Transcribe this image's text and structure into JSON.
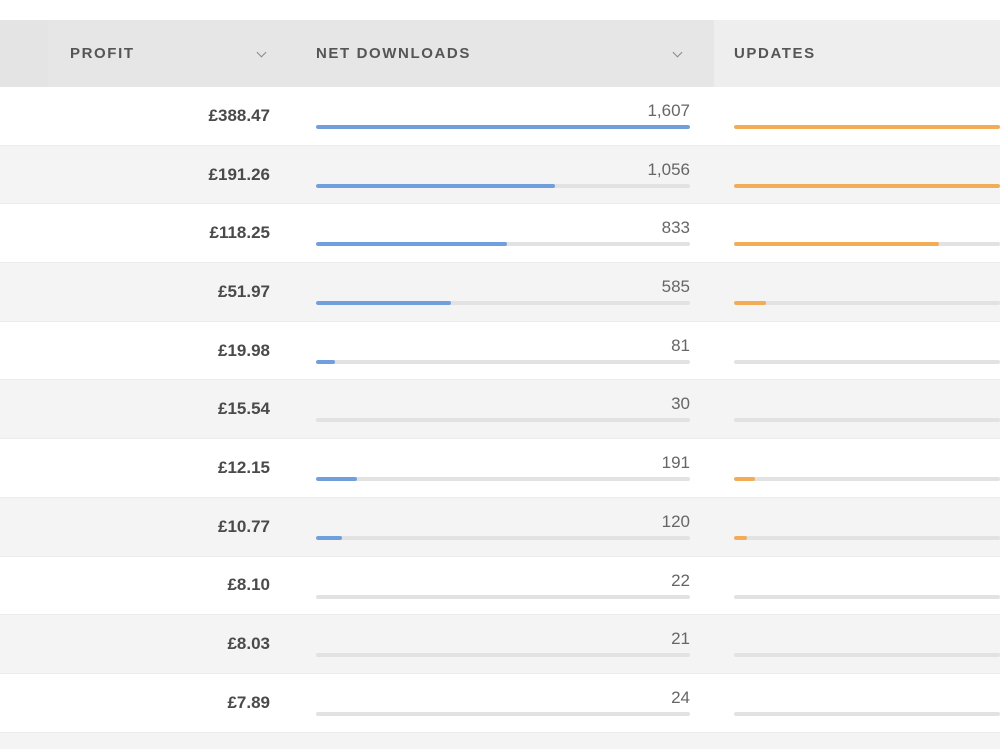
{
  "header": {
    "profit_label": "PROFIT",
    "net_downloads_label": "NET DOWNLOADS",
    "updates_label": "UPDATES"
  },
  "colors": {
    "net_downloads_bar": "#6f9fdc",
    "updates_bar": "#f2ac58",
    "track": "#e2e2e2"
  },
  "rows": [
    {
      "profit": "£388.47",
      "net_downloads": "1,607",
      "net_fraction": 1.0,
      "updates_fraction": 1.0
    },
    {
      "profit": "£191.26",
      "net_downloads": "1,056",
      "net_fraction": 0.64,
      "updates_fraction": 1.0
    },
    {
      "profit": "£118.25",
      "net_downloads": "833",
      "net_fraction": 0.51,
      "updates_fraction": 0.77
    },
    {
      "profit": "£51.97",
      "net_downloads": "585",
      "net_fraction": 0.36,
      "updates_fraction": 0.12
    },
    {
      "profit": "£19.98",
      "net_downloads": "81",
      "net_fraction": 0.05,
      "updates_fraction": 0.0
    },
    {
      "profit": "£15.54",
      "net_downloads": "30",
      "net_fraction": 0.0,
      "updates_fraction": 0.0
    },
    {
      "profit": "£12.15",
      "net_downloads": "191",
      "net_fraction": 0.11,
      "updates_fraction": 0.08
    },
    {
      "profit": "£10.77",
      "net_downloads": "120",
      "net_fraction": 0.07,
      "updates_fraction": 0.05
    },
    {
      "profit": "£8.10",
      "net_downloads": "22",
      "net_fraction": 0.0,
      "updates_fraction": 0.0
    },
    {
      "profit": "£8.03",
      "net_downloads": "21",
      "net_fraction": 0.0,
      "updates_fraction": 0.0
    },
    {
      "profit": "£7.89",
      "net_downloads": "24",
      "net_fraction": 0.0,
      "updates_fraction": 0.0
    }
  ]
}
